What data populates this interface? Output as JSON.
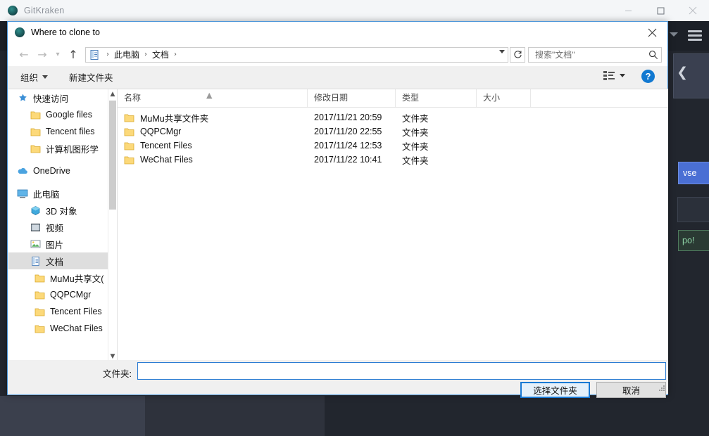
{
  "background_app": {
    "title": "GitKraken",
    "icon": "gitkraken-logo-icon",
    "window_buttons": {
      "minimize": "minimize-icon",
      "maximize": "maximize-icon",
      "close": "close-icon"
    },
    "browse_button_label": "vse",
    "repo_button_label": "po!",
    "menu_icon": "hamburger-menu-icon",
    "collapse_icon": "chevron-left-icon",
    "colors": {
      "chrome": "#1c2027",
      "body": "#22262e",
      "accent_blue": "#4a6fd4",
      "accent_green": "#8fd4a6"
    }
  },
  "dialog": {
    "title": "Where to clone to",
    "icon": "gitkraken-logo-icon",
    "close_icon": "close-icon",
    "nav": {
      "back_icon": "arrow-left-icon",
      "forward_icon": "arrow-right-icon",
      "history_icon": "chevron-down-icon",
      "up_icon": "arrow-up-icon",
      "refresh_icon": "refresh-icon",
      "address_icon": "documents-folder-icon",
      "breadcrumbs": [
        "此电脑",
        "文档"
      ],
      "separator": "›",
      "dropdown_icon": "chevron-down-icon"
    },
    "search": {
      "placeholder": "搜索\"文档\"",
      "value": "",
      "icon": "search-icon"
    },
    "commandbar": {
      "organize_label": "组织",
      "organize_caret": "chevron-down-icon",
      "new_folder_label": "新建文件夹",
      "view_icon": "view-layout-icon",
      "view_caret": "chevron-down-icon",
      "help_icon": "help-icon",
      "help_label": "?"
    },
    "navpane": {
      "scroll_up_icon": "chevron-up-icon",
      "scroll_down_icon": "chevron-down-icon",
      "items": [
        {
          "label": "快速访问",
          "icon": "pin-star-icon",
          "indent": 0,
          "selected": false
        },
        {
          "label": "Google files",
          "icon": "folder-icon",
          "indent": 1,
          "selected": false
        },
        {
          "label": "Tencent files",
          "icon": "folder-icon",
          "indent": 1,
          "selected": false
        },
        {
          "label": "计算机图形学",
          "icon": "folder-icon",
          "indent": 1,
          "selected": false
        },
        {
          "label": "OneDrive",
          "icon": "onedrive-cloud-icon",
          "indent": 0,
          "selected": false
        },
        {
          "label": "此电脑",
          "icon": "this-pc-icon",
          "indent": 0,
          "selected": false
        },
        {
          "label": "3D 对象",
          "icon": "3d-objects-icon",
          "indent": 1,
          "selected": false
        },
        {
          "label": "视频",
          "icon": "videos-icon",
          "indent": 1,
          "selected": false
        },
        {
          "label": "图片",
          "icon": "pictures-icon",
          "indent": 1,
          "selected": false
        },
        {
          "label": "文档",
          "icon": "documents-icon",
          "indent": 1,
          "selected": true
        },
        {
          "label": "MuMu共享文(",
          "icon": "folder-icon",
          "indent": 2,
          "selected": false
        },
        {
          "label": "QQPCMgr",
          "icon": "folder-icon",
          "indent": 2,
          "selected": false
        },
        {
          "label": "Tencent Files",
          "icon": "folder-icon",
          "indent": 2,
          "selected": false
        },
        {
          "label": "WeChat Files",
          "icon": "folder-icon",
          "indent": 2,
          "selected": false
        }
      ]
    },
    "filelist": {
      "columns": [
        "名称",
        "修改日期",
        "类型",
        "大小"
      ],
      "sort_indicator": "sort-ascending-icon",
      "rows": [
        {
          "name": "MuMu共享文件夹",
          "modified": "2017/11/21 20:59",
          "type": "文件夹",
          "size": "",
          "icon": "folder-icon"
        },
        {
          "name": "QQPCMgr",
          "modified": "2017/11/20 22:55",
          "type": "文件夹",
          "size": "",
          "icon": "folder-icon"
        },
        {
          "name": "Tencent Files",
          "modified": "2017/11/24 12:53",
          "type": "文件夹",
          "size": "",
          "icon": "folder-icon"
        },
        {
          "name": "WeChat Files",
          "modified": "2017/11/22 10:41",
          "type": "文件夹",
          "size": "",
          "icon": "folder-icon"
        }
      ]
    },
    "footer": {
      "folder_label": "文件夹:",
      "folder_value": "",
      "folder_placeholder": "",
      "select_button": "选择文件夹",
      "cancel_button": "取消",
      "resize_grip_icon": "resize-grip-icon"
    },
    "colors": {
      "focus_border": "#2b7cd3",
      "chrome": "#f0f0f0",
      "selection": "#dedede"
    }
  }
}
